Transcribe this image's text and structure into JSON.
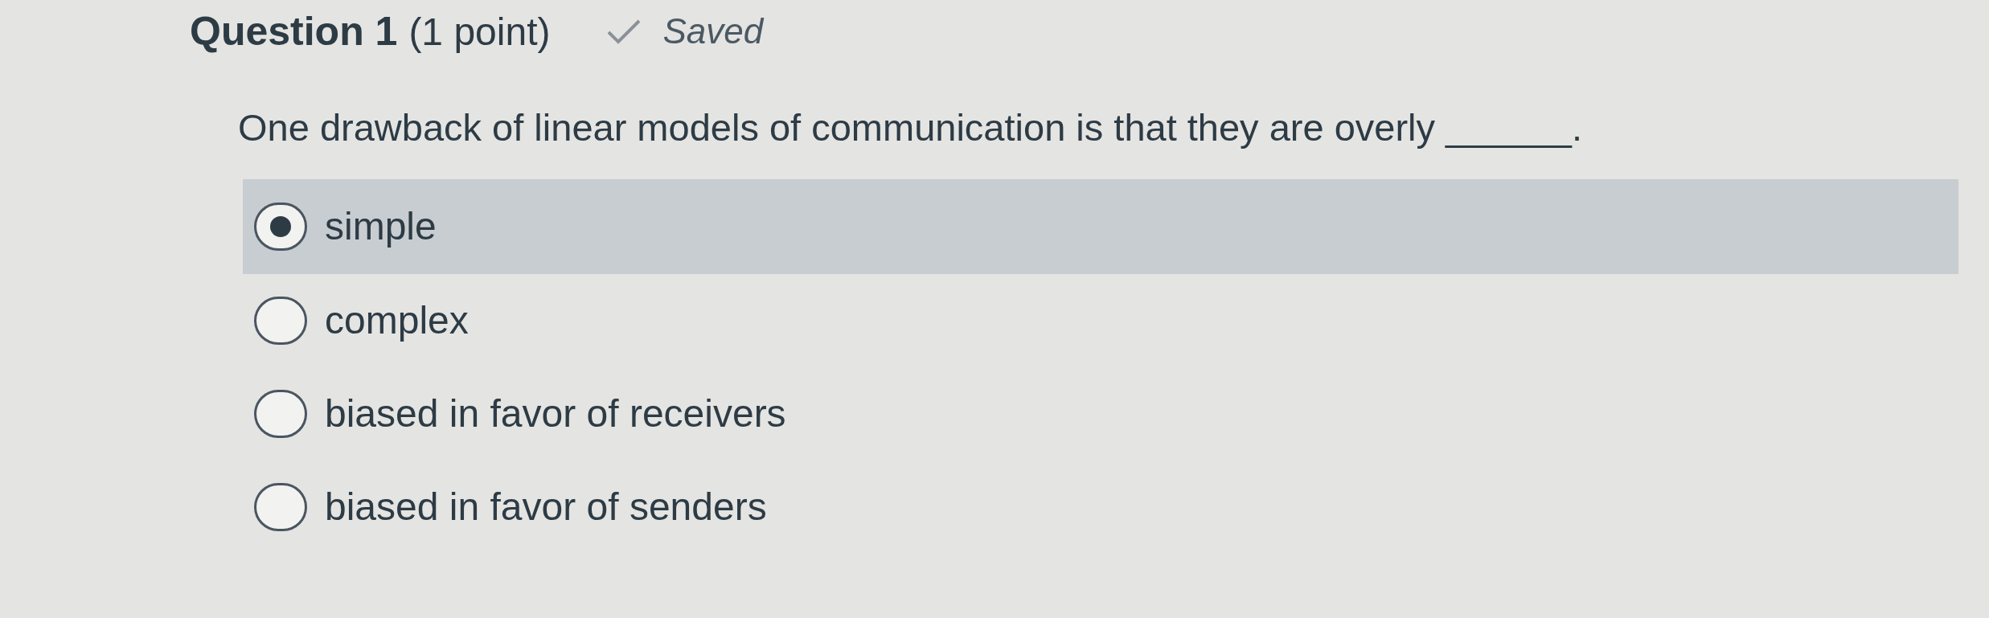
{
  "question": {
    "title": "Question 1",
    "points": "(1 point)",
    "status": "Saved",
    "saved": true,
    "text": "One drawback of linear models of communication is that they are overly ______."
  },
  "options": [
    {
      "label": "simple",
      "selected": true
    },
    {
      "label": "complex",
      "selected": false
    },
    {
      "label": "biased in favor of receivers",
      "selected": false
    },
    {
      "label": "biased in favor of senders",
      "selected": false
    }
  ]
}
